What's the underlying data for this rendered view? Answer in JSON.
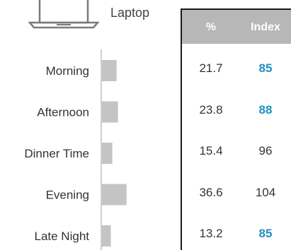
{
  "device": {
    "label": "Laptop",
    "icon": "laptop-icon"
  },
  "table": {
    "headers": [
      "%",
      "Index"
    ],
    "header_bg": "#b7b7b7",
    "highlight_color": "#1f8fc5",
    "rows": [
      {
        "pct": "21.7",
        "index": "85",
        "highlight": true
      },
      {
        "pct": "23.8",
        "index": "88",
        "highlight": true
      },
      {
        "pct": "15.4",
        "index": "96",
        "highlight": false
      },
      {
        "pct": "36.6",
        "index": "104",
        "highlight": false
      },
      {
        "pct": "13.2",
        "index": "85",
        "highlight": true
      }
    ]
  },
  "chart_data": {
    "type": "bar",
    "orientation": "horizontal",
    "categories": [
      "Morning",
      "Afternoon",
      "Dinner Time",
      "Evening",
      "Late Night"
    ],
    "values": [
      21.7,
      23.8,
      15.4,
      36.6,
      13.2
    ],
    "xlim": [
      0,
      40
    ],
    "bar_color": "#c4c4c4",
    "grid": false,
    "legend": "none"
  }
}
